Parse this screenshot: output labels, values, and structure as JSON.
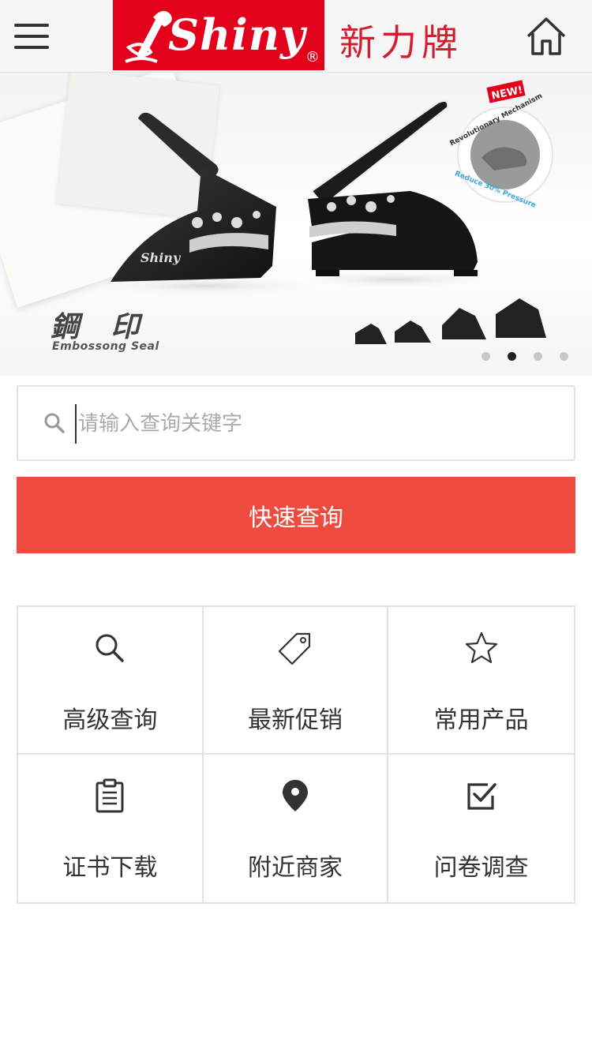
{
  "header": {
    "logo_text": "Shiny",
    "logo_mark": "®",
    "brand_cn": "新力牌",
    "menu_icon": "hamburger-menu-icon",
    "home_icon": "home-icon"
  },
  "banner": {
    "title_cn": "鋼 印",
    "title_en": "Embossong Seal",
    "badge_new": "NEW!",
    "badge_arc_top": "Revolutionary Mechanism",
    "badge_arc_bottom": "Reduce 30% Pressure",
    "slide_count": 4,
    "active_slide": 2
  },
  "search": {
    "placeholder": "请输入查询关键字",
    "button_label": "快速查询",
    "accent_color": "#ee4b40"
  },
  "menu_grid": [
    {
      "label": "高级查询",
      "icon": "search-icon"
    },
    {
      "label": "最新促销",
      "icon": "tag-icon"
    },
    {
      "label": "常用产品",
      "icon": "star-icon"
    },
    {
      "label": "证书下载",
      "icon": "clipboard-icon"
    },
    {
      "label": "附近商家",
      "icon": "map-pin-icon"
    },
    {
      "label": "问卷调查",
      "icon": "checkbox-icon"
    }
  ]
}
